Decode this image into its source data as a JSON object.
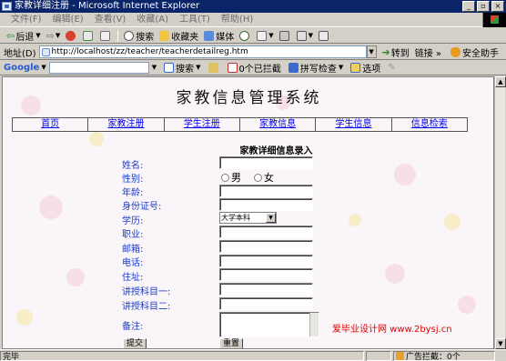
{
  "window": {
    "title": "家教详细注册 - Microsoft Internet Explorer",
    "controls": [
      "_",
      "▫",
      "×"
    ]
  },
  "menu": [
    "文件(F)",
    "编辑(E)",
    "查看(V)",
    "收藏(A)",
    "工具(T)",
    "帮助(H)"
  ],
  "toolbar": {
    "back": "后退",
    "search": "搜索",
    "favorites": "收藏夹",
    "media": "媒体"
  },
  "address": {
    "label": "地址(D)",
    "url": "http://localhost/zz/teacher/teacherdetailreg.htm",
    "goto": "转到",
    "links": "链接",
    "more": "»",
    "safety": "安全助手"
  },
  "google": {
    "logo": "Google",
    "search": "搜索",
    "blocked": "0个已拦截",
    "spell": "拼写检查",
    "options": "选项"
  },
  "page": {
    "site_title": "家教信息管理系统",
    "nav": [
      "首页",
      "家教注册",
      "学生注册",
      "家教信息",
      "学生信息",
      "信息检索"
    ],
    "form_title": "家教详细信息录入",
    "labels": {
      "name": "姓名:",
      "gender": "性别:",
      "age": "年龄:",
      "idcard": "身份证号:",
      "education": "学历:",
      "job": "职业:",
      "email": "邮箱:",
      "phone": "电话:",
      "address": "住址:",
      "subject1": "讲授科目一:",
      "subject2": "讲授科目二:",
      "remark": "备注:"
    },
    "gender_options": [
      "男",
      "女"
    ],
    "education_value": "大学本科",
    "submit": "提交",
    "reset": "重置",
    "watermark": "爱毕业设计网 www.2bysj.cn"
  },
  "status": {
    "text": "完毕",
    "blocker": "广告拦截：0个"
  },
  "colors": {
    "titlebar": "#0a246a",
    "link": "#0000ee",
    "label": "#1a3ccc",
    "watermark": "#e00000"
  }
}
